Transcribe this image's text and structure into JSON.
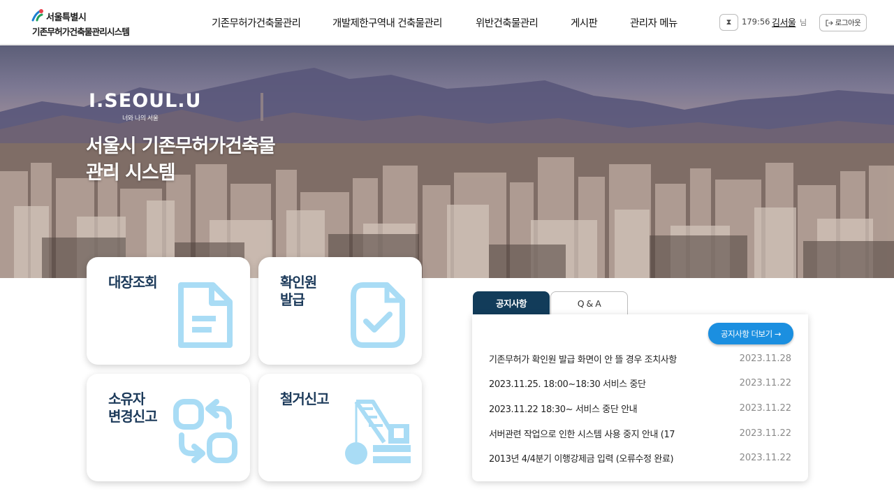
{
  "header": {
    "logo_city": "서울특별시",
    "logo_system": "기존무허가건축물관리시스템",
    "nav": [
      {
        "label": "기존무허가건축물관리"
      },
      {
        "label": "개발제한구역내 건축물관리"
      },
      {
        "label": "위반건축물관리"
      },
      {
        "label": "게시판"
      },
      {
        "label": "관리자 메뉴"
      }
    ],
    "session_timer": "179:56",
    "user_name": "김서울",
    "user_suffix": "님",
    "logout_label": "로그아웃"
  },
  "hero": {
    "brand": "I.SEOUL.U",
    "brand_sub": "너와 나의 서울",
    "title_line1": "서울시 기존무허가건축물",
    "title_line2": "관리 시스템"
  },
  "cards": [
    {
      "title_line1": "대장조회",
      "title_line2": "",
      "icon": "document-icon"
    },
    {
      "title_line1": "확인원",
      "title_line2": "발급",
      "icon": "certificate-check-icon"
    },
    {
      "title_line1": "소유자",
      "title_line2": "변경신고",
      "icon": "owner-change-arrows-icon"
    },
    {
      "title_line1": "철거신고",
      "title_line2": "",
      "icon": "demolition-crane-icon"
    }
  ],
  "notice": {
    "tabs": [
      {
        "label": "공지사항",
        "active": true
      },
      {
        "label": "Q & A",
        "active": false
      }
    ],
    "more_label": "공지사항 더보기 →",
    "items": [
      {
        "title": "기존무허가 확인원 발급 화면이 안 뜰 경우 조치사항",
        "date": "2023.11.28"
      },
      {
        "title": "2023.11.25. 18:00~18:30 서비스 중단",
        "date": "2023.11.22"
      },
      {
        "title": "2023.11.22 18:30~ 서비스 중단 안내",
        "date": "2023.11.22"
      },
      {
        "title": "서버관련 작업으로 인한 시스템 사용 중지 안내 (17",
        "date": "2023.11.22"
      },
      {
        "title": "2013년 4/4분기 이행강제금 입력 (오류수정 완료)",
        "date": "2023.11.22"
      }
    ]
  },
  "colors": {
    "accent_navy": "#123c5a",
    "accent_blue": "#1b8fe0",
    "icon_light_blue": "#a9dcf5",
    "card_title": "#1c3a5a"
  }
}
